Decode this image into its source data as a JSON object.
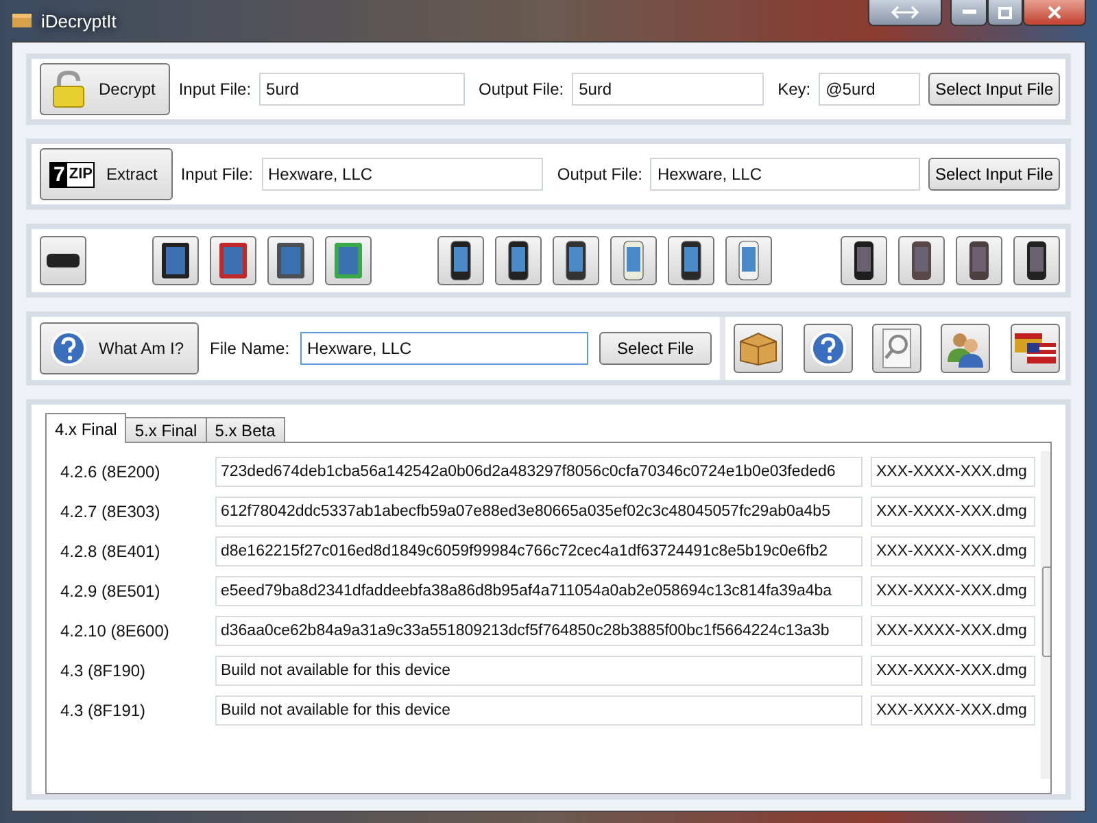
{
  "window": {
    "title": "iDecryptIt"
  },
  "decrypt": {
    "button": "Decrypt",
    "input_label": "Input File:",
    "input_value": "5urd",
    "output_label": "Output File:",
    "output_value": "5urd",
    "key_label": "Key:",
    "key_value": "@5urd",
    "select_button": "Select Input File"
  },
  "extract": {
    "button": "Extract",
    "logo_digit": "7",
    "logo_text": "ZIP",
    "input_label": "Input File:",
    "input_value": "Hexware, LLC",
    "output_label": "Output File:",
    "output_value": "Hexware, LLC",
    "select_button": "Select Input File"
  },
  "device_groups": [
    [
      {
        "kind": "tv",
        "color": "#222222"
      }
    ],
    [
      {
        "kind": "tablet",
        "color": "#222222"
      },
      {
        "kind": "tablet",
        "color": "#c0282a"
      },
      {
        "kind": "tablet",
        "color": "#4a4f55"
      },
      {
        "kind": "tablet",
        "color": "#3aa84a"
      }
    ],
    [
      {
        "kind": "phone",
        "color": "#222222"
      },
      {
        "kind": "phone",
        "color": "#222222"
      },
      {
        "kind": "phone",
        "color": "#333333"
      },
      {
        "kind": "phone",
        "color": "#e8ecd8"
      },
      {
        "kind": "phone",
        "color": "#2a2a2a"
      },
      {
        "kind": "phone",
        "color": "#f2f2f2"
      }
    ],
    [
      {
        "kind": "player",
        "color": "#1e1e1e"
      },
      {
        "kind": "player",
        "color": "#5a4848"
      },
      {
        "kind": "player",
        "color": "#4a4040"
      },
      {
        "kind": "player",
        "color": "#222222"
      }
    ]
  ],
  "whatami": {
    "button": "What Am I?",
    "file_label": "File Name:",
    "file_value": "Hexware, LLC",
    "select_button": "Select File"
  },
  "tools": [
    {
      "kind": "box"
    },
    {
      "kind": "help"
    },
    {
      "kind": "search"
    },
    {
      "kind": "people"
    },
    {
      "kind": "flags"
    }
  ],
  "tabs": [
    {
      "label": "4.x Final",
      "selected": true
    },
    {
      "label": "5.x Final",
      "selected": false
    },
    {
      "label": "5.x Beta",
      "selected": false
    }
  ],
  "rows": [
    {
      "version": "4.2.6 (8E200)",
      "key": "723ded674deb1cba56a142542a0b06d2a483297f8056c0cfa70346c0724e1b0e03feded6",
      "file": "XXX-XXXX-XXX.dmg"
    },
    {
      "version": "4.2.7 (8E303)",
      "key": "612f78042ddc5337ab1abecfb59a07e88ed3e80665a035ef02c3c48045057fc29ab0a4b5",
      "file": "XXX-XXXX-XXX.dmg"
    },
    {
      "version": "4.2.8 (8E401)",
      "key": "d8e162215f27c016ed8d1849c6059f99984c766c72cec4a1df63724491c8e5b19c0e6fb2",
      "file": "XXX-XXXX-XXX.dmg"
    },
    {
      "version": "4.2.9 (8E501)",
      "key": "e5eed79ba8d2341dfaddeebfa38a86d8b95af4a711054a0ab2e058694c13c814fa39a4ba",
      "file": "XXX-XXXX-XXX.dmg"
    },
    {
      "version": "4.2.10 (8E600)",
      "key": "d36aa0ce62b84a9a31a9c33a551809213dcf5f764850c28b3885f00bc1f5664224c13a3b",
      "file": "XXX-XXXX-XXX.dmg"
    },
    {
      "version": "4.3 (8F190)",
      "key": "Build not available for this device",
      "file": "XXX-XXXX-XXX.dmg"
    },
    {
      "version": "4.3 (8F191)",
      "key": "Build not available for this device",
      "file": "XXX-XXXX-XXX.dmg"
    }
  ]
}
